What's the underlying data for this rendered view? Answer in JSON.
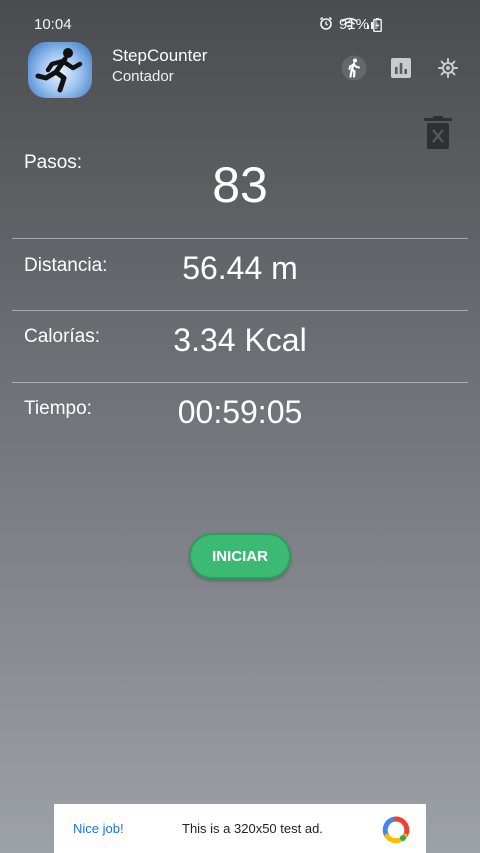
{
  "status_bar": {
    "time": "10:04",
    "battery": "91%",
    "icons": [
      "alarm-icon",
      "wifi-icon",
      "signal-icon",
      "battery-charging-icon"
    ]
  },
  "app_bar": {
    "title": "StepCounter",
    "subtitle": "Contador",
    "actions": [
      "walking-icon",
      "bar-chart-icon",
      "settings-icon"
    ]
  },
  "stats": {
    "steps": {
      "label": "Pasos:",
      "value": "83"
    },
    "distance": {
      "label": "Distancia:",
      "value": "56.44 m"
    },
    "calories": {
      "label": "Calorías:",
      "value": "3.34 Kcal"
    },
    "time": {
      "label": "Tiempo:",
      "value": "00:59:05"
    }
  },
  "start_button": {
    "label": "INICIAR",
    "color": "#3cba74"
  },
  "ad": {
    "badge": "Nice job!",
    "text": "This is a 320x50 test ad."
  }
}
